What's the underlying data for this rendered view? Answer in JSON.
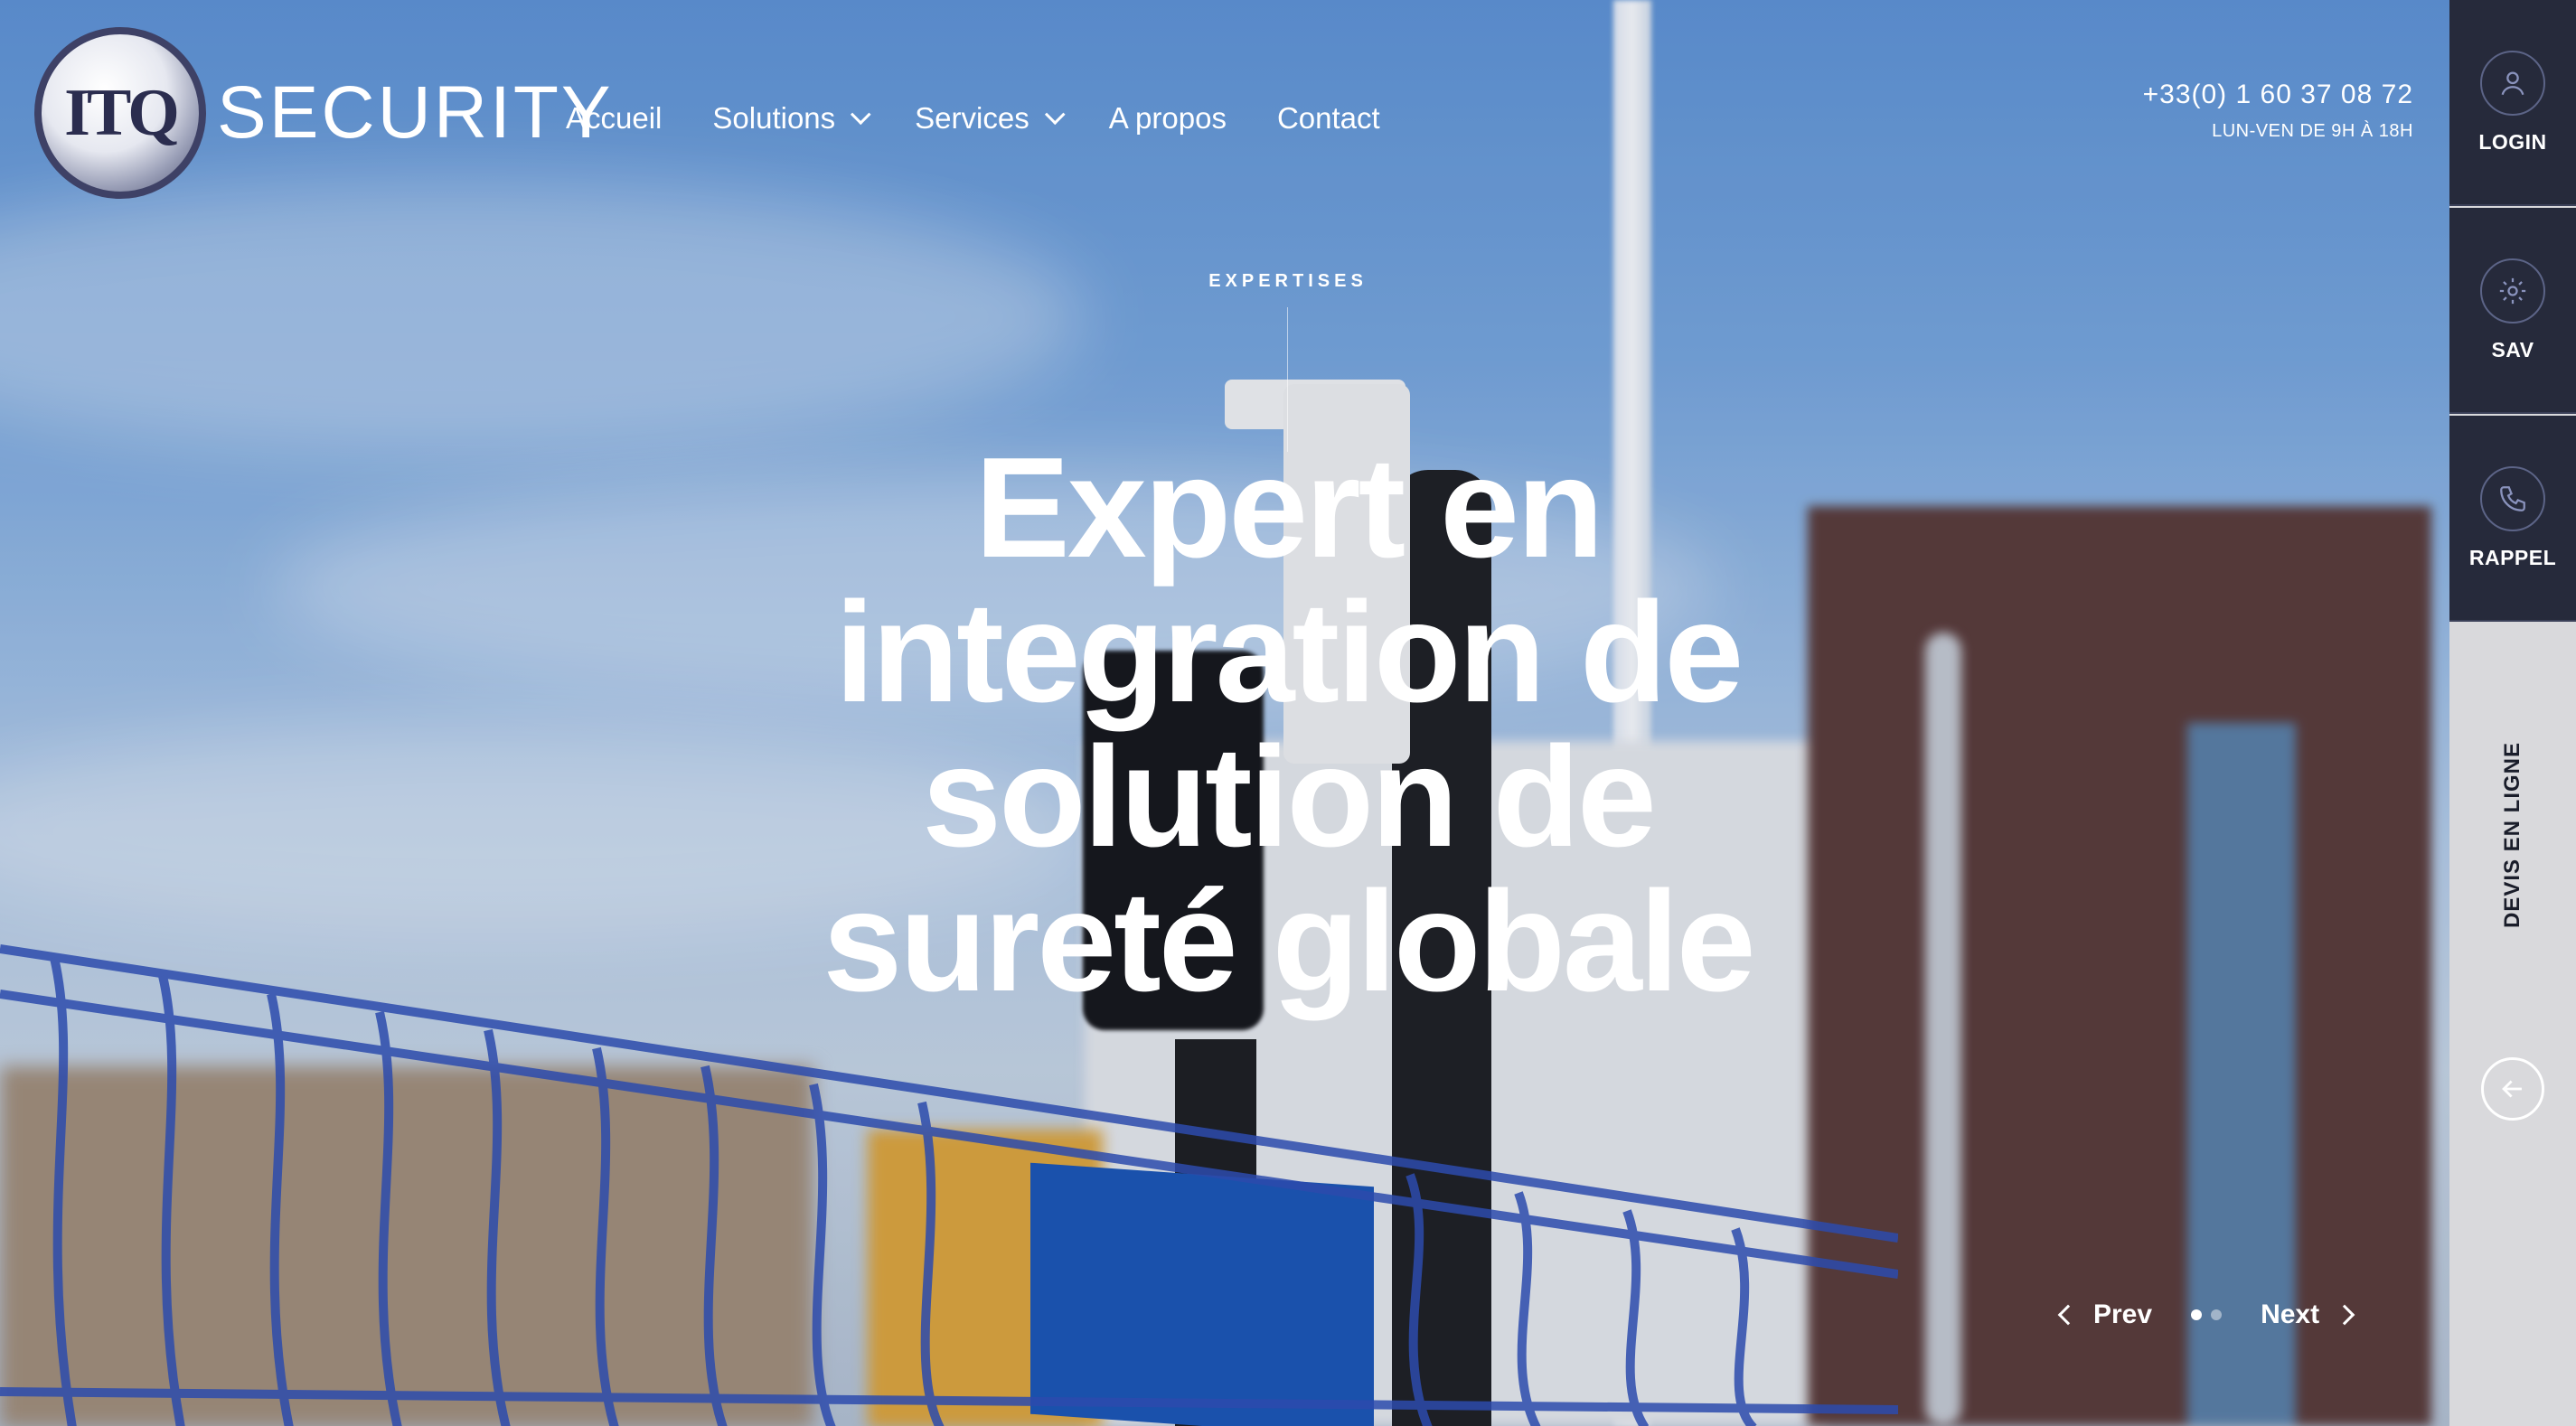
{
  "brand": {
    "logo_mark": "ITQ",
    "logo_word": "SECURITY"
  },
  "nav": {
    "items": [
      {
        "label": "Accueil",
        "has_dropdown": false
      },
      {
        "label": "Solutions",
        "has_dropdown": true
      },
      {
        "label": "Services",
        "has_dropdown": true
      },
      {
        "label": "A propos",
        "has_dropdown": false
      },
      {
        "label": "Contact",
        "has_dropdown": false
      }
    ]
  },
  "contact": {
    "phone": "+33(0) 1 60 37 08 72",
    "hours": "LUN-VEN DE 9H À 18H"
  },
  "hero": {
    "kicker": "EXPERTISES",
    "headline_lines": [
      "Expert en",
      "integration de",
      "solution de",
      "sureté globale"
    ]
  },
  "slider": {
    "prev_label": "Prev",
    "next_label": "Next",
    "total_slides": 2,
    "active_slide": 1
  },
  "sidebar": {
    "buttons": [
      {
        "label": "LOGIN",
        "icon": "user-icon"
      },
      {
        "label": "SAV",
        "icon": "gear-icon"
      },
      {
        "label": "RAPPEL",
        "icon": "phone-icon"
      }
    ],
    "devis_label": "DEVIS EN LIGNE",
    "devis_icon": "arrow-left-icon"
  },
  "colors": {
    "sidebar_dark": "#262a3b",
    "sidebar_light": "#d9d9dc",
    "text_white": "#ffffff"
  }
}
